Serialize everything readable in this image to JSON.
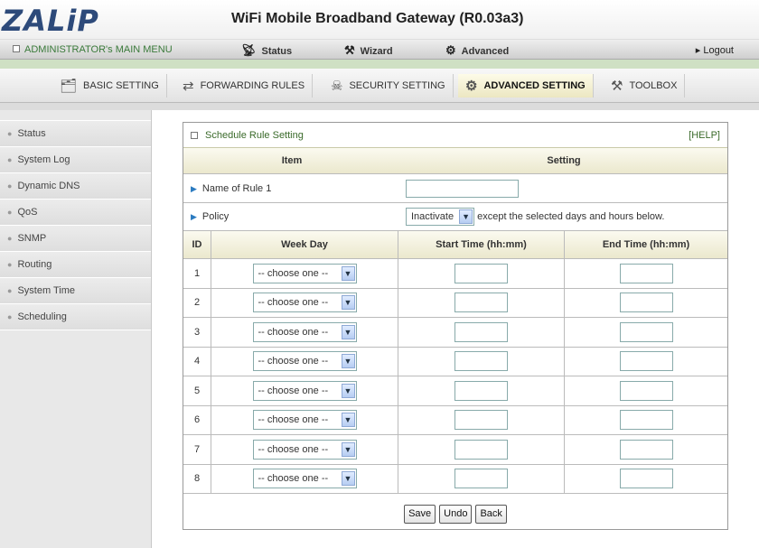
{
  "header": {
    "logo": "ZALiP",
    "title": "WiFi Mobile Broadband Gateway (R0.03a3)"
  },
  "menubar": {
    "admin_label": "ADMINISTRATOR's MAIN MENU",
    "items": [
      {
        "label": "Status",
        "icon": "antenna-icon"
      },
      {
        "label": "Wizard",
        "icon": "wizard-icon"
      },
      {
        "label": "Advanced",
        "icon": "advanced-icon"
      }
    ],
    "logout": "Logout"
  },
  "tabs": [
    {
      "label": "BASIC SETTING",
      "icon": "folder-icon"
    },
    {
      "label": "FORWARDING RULES",
      "icon": "forward-icon"
    },
    {
      "label": "SECURITY SETTING",
      "icon": "security-icon"
    },
    {
      "label": "ADVANCED SETTING",
      "icon": "advanced-icon",
      "active": true
    },
    {
      "label": "TOOLBOX",
      "icon": "toolbox-icon"
    }
  ],
  "sidebar": {
    "items": [
      {
        "label": "Status"
      },
      {
        "label": "System Log"
      },
      {
        "label": "Dynamic DNS"
      },
      {
        "label": "QoS"
      },
      {
        "label": "SNMP"
      },
      {
        "label": "Routing"
      },
      {
        "label": "System Time"
      },
      {
        "label": "Scheduling"
      }
    ]
  },
  "panel": {
    "title": "Schedule Rule Setting",
    "help": "[HELP]",
    "col_item": "Item",
    "col_setting": "Setting",
    "name_label": "Name of Rule 1",
    "name_value": "",
    "policy_label": "Policy",
    "policy_value": "Inactivate",
    "policy_suffix": "except the selected days and hours below.",
    "grid_headers": {
      "id": "ID",
      "week_day": "Week Day",
      "start": "Start Time (hh:mm)",
      "end": "End Time (hh:mm)"
    },
    "rows": [
      {
        "id": "1",
        "day": "-- choose one --",
        "start": "",
        "end": ""
      },
      {
        "id": "2",
        "day": "-- choose one --",
        "start": "",
        "end": ""
      },
      {
        "id": "3",
        "day": "-- choose one --",
        "start": "",
        "end": ""
      },
      {
        "id": "4",
        "day": "-- choose one --",
        "start": "",
        "end": ""
      },
      {
        "id": "5",
        "day": "-- choose one --",
        "start": "",
        "end": ""
      },
      {
        "id": "6",
        "day": "-- choose one --",
        "start": "",
        "end": ""
      },
      {
        "id": "7",
        "day": "-- choose one --",
        "start": "",
        "end": ""
      },
      {
        "id": "8",
        "day": "-- choose one --",
        "start": "",
        "end": ""
      }
    ],
    "buttons": {
      "save": "Save",
      "undo": "Undo",
      "back": "Back"
    }
  }
}
